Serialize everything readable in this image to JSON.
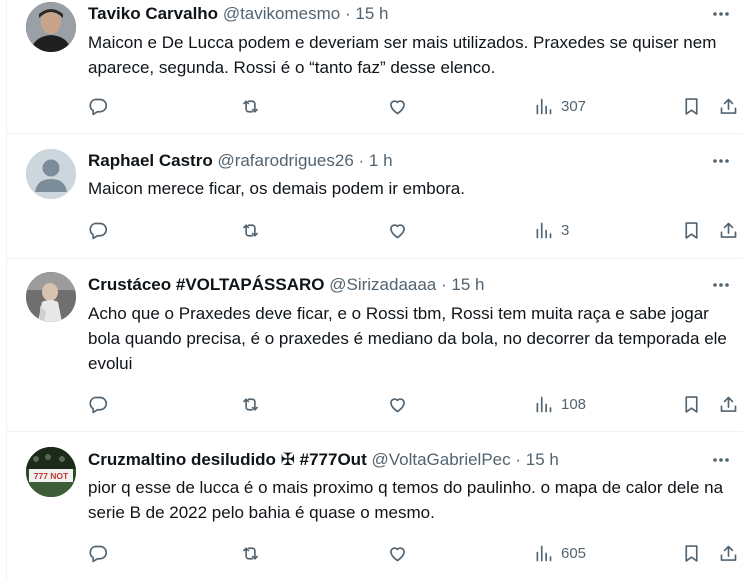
{
  "tweets": [
    {
      "name": "Taviko Carvalho",
      "handle": "@tavikomesmo",
      "separator": "·",
      "time": "15 h",
      "text": "Maicon e De Lucca podem e deveriam ser mais utilizados. Praxedes se quiser nem aparece, segunda. Rossi é o “tanto faz” desse elenco.",
      "views": "307",
      "avatar_color": "#3b3b3b"
    },
    {
      "name": "Raphael Castro",
      "handle": "@rafarodrigues26",
      "separator": "·",
      "time": "1 h",
      "text": "Maicon merece ficar, os demais podem ir embora.",
      "views": "3",
      "avatar_color": "#ccd6dd"
    },
    {
      "name": "Crustáceo #VOLTAPÁSSARO",
      "handle": "@Sirizadaaaa",
      "separator": "·",
      "time": "15 h",
      "text": "Acho que o Praxedes deve ficar, e o Rossi tbm, Rossi tem muita raça e sabe jogar bola quando precisa, é o praxedes é mediano da bola, no decorrer da temporada ele evolui",
      "views": "108",
      "avatar_color": "#8a8a8a"
    },
    {
      "name": "Cruzmaltino desiludido ✠ #777Out",
      "handle": "@VoltaGabrielPec",
      "separator": "·",
      "time": "15 h",
      "text": "pior q esse de lucca é o mais proximo q temos do paulinho. o mapa de calor dele na serie B de 2022 pelo bahia é quase o mesmo.",
      "views": "605",
      "avatar_color": "#2e4a2a",
      "avatar_text": "777 NOT"
    }
  ],
  "colors": {
    "name": "#0f1419",
    "secondary": "#536471",
    "border": "#eff3f4",
    "background": "#ffffff"
  },
  "icons": [
    "reply-icon",
    "retweet-icon",
    "like-icon",
    "views-icon",
    "bookmark-icon",
    "share-icon",
    "more-icon"
  ]
}
